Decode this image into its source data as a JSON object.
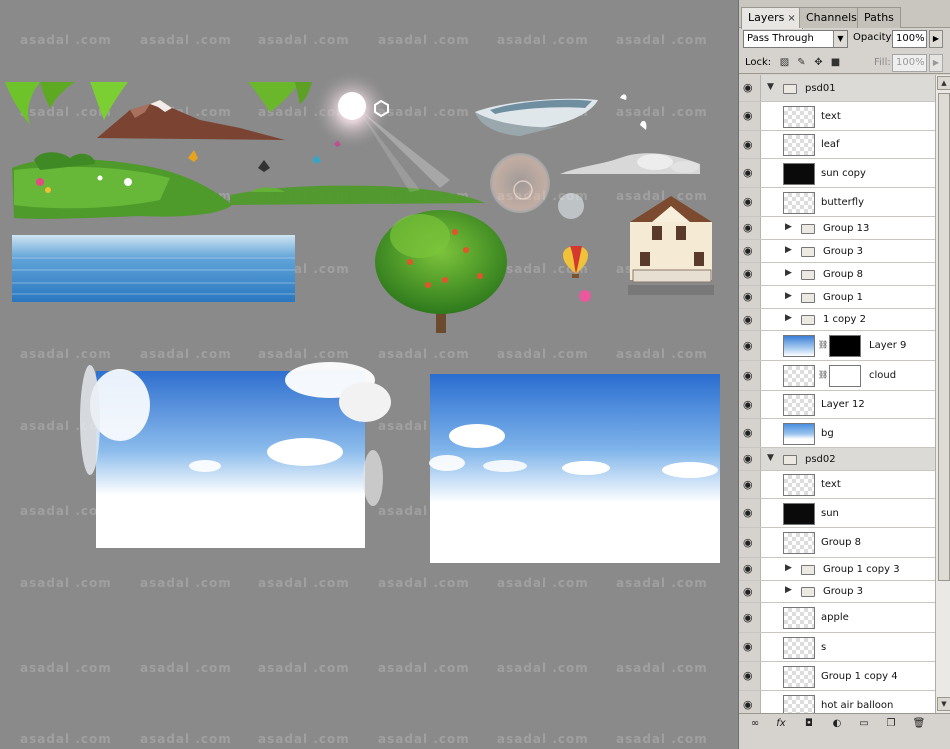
{
  "watermark": "asadal .com",
  "panel": {
    "tabs": [
      {
        "label": "Layers",
        "close": "×",
        "active": true
      },
      {
        "label": "Channels",
        "active": false
      },
      {
        "label": "Paths",
        "active": false
      }
    ],
    "blend_mode": "Pass Through",
    "opacity_label": "Opacity:",
    "opacity_value": "100%",
    "lock_label": "Lock:",
    "fill_label": "Fill:",
    "fill_value": "100%",
    "layers": [
      {
        "name": "psd01",
        "kind": "group-open",
        "level": 0
      },
      {
        "name": "text",
        "kind": "layer",
        "level": 1,
        "thumb": "checker"
      },
      {
        "name": "leaf",
        "kind": "layer",
        "level": 1,
        "thumb": "checker"
      },
      {
        "name": "sun copy",
        "kind": "layer",
        "level": 1,
        "thumb": "dark"
      },
      {
        "name": "butterfly",
        "kind": "layer",
        "level": 1,
        "thumb": "checker"
      },
      {
        "name": "Group 13",
        "kind": "group-closed",
        "level": 1
      },
      {
        "name": "Group 3",
        "kind": "group-closed",
        "level": 1
      },
      {
        "name": "Group 8",
        "kind": "group-closed",
        "level": 1
      },
      {
        "name": "Group 1",
        "kind": "group-closed",
        "level": 1
      },
      {
        "name": "1 copy 2",
        "kind": "group-closed",
        "level": 1
      },
      {
        "name": "Layer 9",
        "kind": "masked",
        "level": 1,
        "thumb": "sky",
        "mask": "mask-black"
      },
      {
        "name": "cloud",
        "kind": "masked",
        "level": 1,
        "thumb": "checker",
        "mask": "mask-cloud"
      },
      {
        "name": "Layer 12",
        "kind": "layer",
        "level": 1,
        "thumb": "checker"
      },
      {
        "name": "bg",
        "kind": "layer",
        "level": 1,
        "thumb": "sky2"
      },
      {
        "name": "psd02",
        "kind": "group-open",
        "level": 0
      },
      {
        "name": "text",
        "kind": "layer",
        "level": 1,
        "thumb": "checker"
      },
      {
        "name": "sun",
        "kind": "layer",
        "level": 1,
        "thumb": "dark"
      },
      {
        "name": "Group 8",
        "kind": "layer",
        "level": 1,
        "thumb": "checker"
      },
      {
        "name": "Group 1 copy 3",
        "kind": "group-closed",
        "level": 1
      },
      {
        "name": "Group 3",
        "kind": "group-closed",
        "level": 1
      },
      {
        "name": "apple",
        "kind": "layer",
        "level": 1,
        "thumb": "checker"
      },
      {
        "name": "s",
        "kind": "layer",
        "level": 1,
        "thumb": "checker"
      },
      {
        "name": "Group 1 copy 4",
        "kind": "layer",
        "level": 1,
        "thumb": "checker"
      },
      {
        "name": "hot air balloon",
        "kind": "layer",
        "level": 1,
        "thumb": "checker"
      }
    ]
  }
}
